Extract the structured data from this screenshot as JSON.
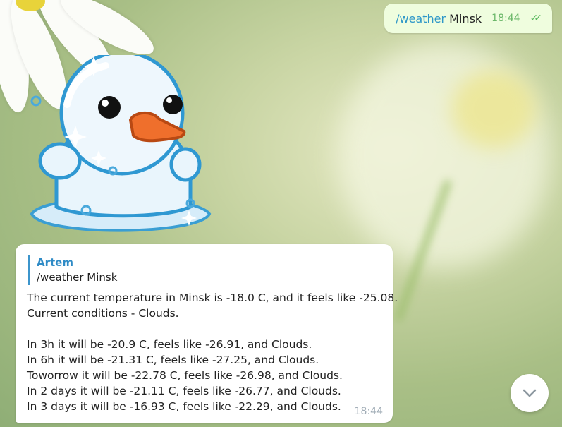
{
  "outgoing": {
    "command": "/weather",
    "city": "Minsk",
    "time": "18:44",
    "status_icon": "double-check-icon"
  },
  "sticker": {
    "name": "snowman-sticker"
  },
  "incoming": {
    "reply": {
      "author": "Artem",
      "text": "/weather Minsk"
    },
    "lines": [
      "The current temperature in Minsk is -18.0 C, and it feels like -25.08.",
      "Current conditions - Clouds.",
      "",
      "In 3h it will be -20.9 C, feels like -26.91, and Clouds.",
      "In 6h it will be -21.31 C, feels like -27.25, and Clouds.",
      "Toworrow it will be -22.78 C, feels like -26.98, and Clouds.",
      "In 2 days it will be -21.11 C, feels like -26.77, and Clouds.",
      "In 3 days it will be -16.93 C, feels like -22.29, and Clouds."
    ],
    "time": "18:44"
  },
  "scroll_button": {
    "icon": "chevron-down-icon"
  },
  "colors": {
    "accent": "#2f8bc6",
    "outgoing_bg": "#effdde",
    "check": "#5ab85e"
  }
}
